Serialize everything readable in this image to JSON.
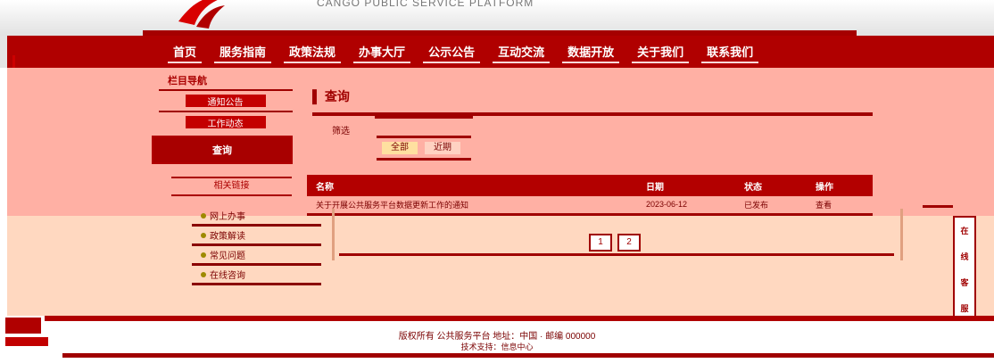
{
  "header": {
    "site_title": "CANGO PUBLIC SERVICE PLATFORM",
    "logo": "red-swoosh-logo"
  },
  "nav": {
    "items": [
      "首页",
      "服务指南",
      "政策法规",
      "办事大厅",
      "公示公告",
      "互动交流",
      "数据开放",
      "关于我们",
      "联系我们"
    ]
  },
  "sidebar": {
    "heading": "栏目导航",
    "buttons": [
      "通知公告",
      "工作动态"
    ],
    "active_label": "查询",
    "section2_label": "相关链接",
    "list": [
      "网上办事",
      "政策解读",
      "常见问题",
      "在线咨询"
    ]
  },
  "main": {
    "heading": "查询",
    "filter_label": "筛选",
    "filter_buttons": [
      "全部",
      "近期"
    ],
    "table": {
      "columns": [
        "名称",
        "日期",
        "状态",
        "操作"
      ],
      "rows": [
        [
          "关于开展公共服务平台数据更新工作的通知",
          "2023-06-12",
          "已发布",
          "查看"
        ]
      ]
    },
    "pager": [
      "1",
      "2"
    ]
  },
  "widget": {
    "glyphs": [
      "在",
      "线",
      "客",
      "服"
    ]
  },
  "footer": {
    "line1": "版权所有 公共服务平台 地址：中国 · 邮编 000000",
    "line2": "技术支持：信息中心"
  },
  "colors": {
    "brand_red": "#b00000",
    "pink_bg": "#ffb0a4",
    "peach_bg": "#ffd8c0"
  }
}
